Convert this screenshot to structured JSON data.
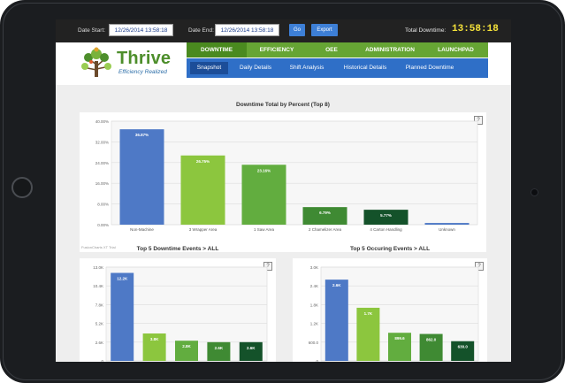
{
  "topbar": {
    "date_start_label": "Date Start:",
    "date_start_value": "12/26/2014 13:58:18",
    "date_end_label": "Date End:",
    "date_end_value": "12/26/2014 13:58:18",
    "go_label": "Go",
    "export_label": "Export",
    "total_downtime_label": "Total Downtime:",
    "total_downtime_value": "13:58:18",
    "timer_color": "#f5e23a"
  },
  "logo": {
    "name": "Thrive",
    "tagline": "Efficiency Realized",
    "icon": "tree-logo-icon"
  },
  "main_nav": [
    "DOWNTIME",
    "EFFICIENCY",
    "OEE",
    "ADMINISTRATION",
    "LAUNCHPAD"
  ],
  "main_nav_active": "DOWNTIME",
  "sub_nav": [
    "Snapshot",
    "Daily Details",
    "Shift Analysis",
    "Historical Details",
    "Planned Downtime"
  ],
  "sub_nav_active": "Snapshot",
  "colors": {
    "nav_green": "#66a534",
    "sub_blue": "#2f6fc7",
    "bar_blue": "#4e79c6"
  },
  "help_label": "?",
  "watermark": "FusionCharts XT Trial",
  "chart_data": [
    {
      "type": "bar",
      "title": "Downtime Total by Percent (Top 8)",
      "categories": [
        "Non-Machine",
        "3 Wrapper Area",
        "1 Saw Area",
        "2 Chamelizer Area",
        "4 Carton Handling",
        "Unknown"
      ],
      "values": [
        36.87,
        26.75,
        23.16,
        6.79,
        5.77,
        0.66
      ],
      "labels": [
        "36.87%",
        "26.75%",
        "23.16%",
        "6.79%",
        "5.77%",
        ""
      ],
      "colors": [
        "#4e79c6",
        "#8cc63e",
        "#62ad3f",
        "#3f8a33",
        "#14522a",
        "#4e79c6"
      ],
      "yticks": [
        "40.00%",
        "32.00%",
        "24.00%",
        "16.00%",
        "8.00%",
        "0.00%"
      ],
      "ylim": [
        0,
        40
      ],
      "grid": true
    },
    {
      "type": "bar",
      "title": "Top 5 Downtime Events > ALL",
      "values": [
        12.2,
        3.8,
        2.8,
        2.6,
        2.6
      ],
      "labels": [
        "12.2K",
        "3.8K",
        "2.8K",
        "2.6K",
        "2.6K"
      ],
      "colors": [
        "#4e79c6",
        "#8cc63e",
        "#62ad3f",
        "#3f8a33",
        "#14522a"
      ],
      "yticks": [
        "13.0K",
        "10.4K",
        "7.8K",
        "5.2K",
        "2.6K",
        "0"
      ],
      "ylim": [
        0,
        13
      ],
      "grid": true
    },
    {
      "type": "bar",
      "title": "Top 5 Occuring Events > ALL",
      "values": [
        2.6,
        1.7,
        0.8996,
        0.862,
        0.63
      ],
      "labels": [
        "2.6K",
        "1.7K",
        "899.6",
        "862.0",
        "630.0"
      ],
      "colors": [
        "#4e79c6",
        "#8cc63e",
        "#62ad3f",
        "#3f8a33",
        "#14522a"
      ],
      "yticks": [
        "3.0K",
        "2.4K",
        "1.8K",
        "1.2K",
        "600.0",
        "0"
      ],
      "ylim": [
        0,
        3
      ],
      "grid": true
    }
  ]
}
